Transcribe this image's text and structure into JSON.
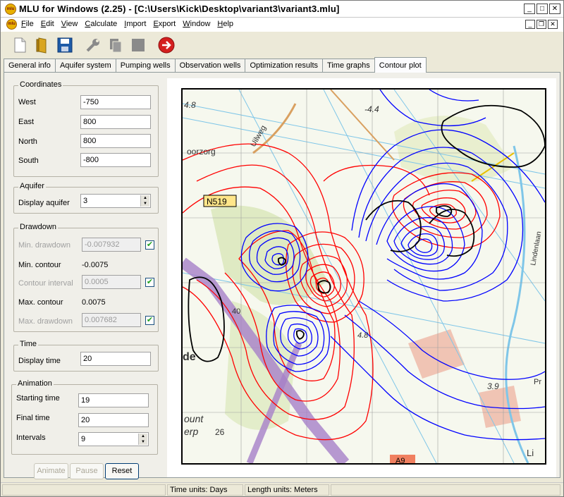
{
  "window": {
    "title": "MLU for Windows (2.25) - [C:\\Users\\Kick\\Desktop\\variant3\\variant3.mlu]",
    "logo_text": "mlu"
  },
  "menu": [
    "File",
    "Edit",
    "View",
    "Calculate",
    "Import",
    "Export",
    "Window",
    "Help"
  ],
  "toolbar": {
    "icons": [
      "new-file-icon",
      "open-folder-icon",
      "save-icon",
      "wrench-icon",
      "copy-icon",
      "stop-icon",
      "go-arrow-icon"
    ]
  },
  "tabs": [
    "General info",
    "Aquifer system",
    "Pumping wells",
    "Observation wells",
    "Optimization results",
    "Time graphs",
    "Contour plot"
  ],
  "active_tab": "Contour plot",
  "coordinates": {
    "label": "Coordinates",
    "west_label": "West",
    "west": "-750",
    "east_label": "East",
    "east": "800",
    "north_label": "North",
    "north": "800",
    "south_label": "South",
    "south": "-800"
  },
  "aquifer": {
    "label": "Aquifer",
    "display_label": "Display aquifer",
    "display_value": "3"
  },
  "drawdown": {
    "label": "Drawdown",
    "min_drawdown_label": "Min. drawdown",
    "min_drawdown": "-0.007932",
    "min_contour_label": "Min. contour",
    "min_contour": "-0.0075",
    "interval_label": "Contour interval",
    "interval": "0.0005",
    "max_contour_label": "Max. contour",
    "max_contour": "0.0075",
    "max_drawdown_label": "Max. drawdown",
    "max_drawdown": "0.007682",
    "check_mark": "✔"
  },
  "time": {
    "label": "Time",
    "display_label": "Display time",
    "display_value": "20"
  },
  "animation": {
    "label": "Animation",
    "start_label": "Starting time",
    "start": "19",
    "final_label": "Final time",
    "final": "20",
    "intervals_label": "Intervals",
    "intervals": "9"
  },
  "buttons": {
    "animate": "Animate",
    "pause": "Pause",
    "reset": "Reset"
  },
  "map_labels": {
    "road_badge": "N519",
    "road_a9": "A9",
    "street_ulweg": "Uilweg",
    "place_oorzorg": "oorzorg",
    "place_de": "de",
    "place_ount": "ount",
    "place_erp": "erp",
    "elev_48a": "4.8",
    "elev_44": "-4.4",
    "elev_48b": "4.8",
    "elev_39": "3.9",
    "elev_26": "26",
    "elev_40": "40",
    "place_lindenlaan": "Lindenlaan",
    "place_li": "Li",
    "place_pr": "Pr"
  },
  "colors": {
    "contour_positive": "#ff0000",
    "contour_negative": "#0000ff",
    "contour_zero": "#000000",
    "water": "#7fc6e8",
    "road": "#a680c8",
    "tab_active": "#fcfcfe"
  },
  "status": {
    "time_units": "Time units: Days",
    "length_units": "Length units: Meters"
  }
}
